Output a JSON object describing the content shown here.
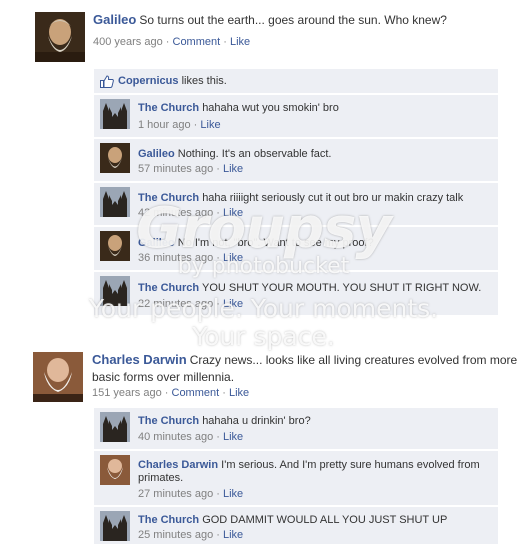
{
  "posts": [
    {
      "author": "Galileo",
      "body": "So turns out the earth... goes around the sun.  Who knew?",
      "time": "400 years ago",
      "comment_label": "Comment",
      "like_label": "Like",
      "likes": {
        "name": "Copernicus",
        "text": "likes this."
      },
      "comments": [
        {
          "author": "The Church",
          "text": "hahaha wut you smokin' bro",
          "time": "1 hour ago",
          "like": "Like"
        },
        {
          "author": "Galileo",
          "text": "Nothing.  It's an observable fact.",
          "time": "57 minutes ago",
          "like": "Like"
        },
        {
          "author": "The Church",
          "text": "haha riiiight seriously cut it out bro ur makin crazy talk",
          "time": "42 minutes ago",
          "like": "Like"
        },
        {
          "author": "Galileo",
          "text": "No I'm not, \"bro\". Want to see my proof?",
          "time": "36 minutes ago",
          "like": "Like"
        },
        {
          "author": "The Church",
          "text": "YOU SHUT YOUR MOUTH.  YOU SHUT IT RIGHT NOW.",
          "time": "22 minutes ago",
          "like": "Like"
        }
      ]
    },
    {
      "author": "Charles Darwin",
      "body": "Crazy news... looks like all living creatures evolved from more basic forms over millennia.",
      "time": "151 years ago",
      "comment_label": "Comment",
      "like_label": "Like",
      "comments": [
        {
          "author": "The Church",
          "text": " hahaha u drinkin' bro?",
          "time": "40 minutes ago",
          "like": "Like"
        },
        {
          "author": "Charles Darwin",
          "text": "I'm serious.  And I'm pretty sure humans evolved from primates.",
          "time": "27 minutes ago",
          "like": "Like"
        },
        {
          "author": "The Church",
          "text": "GOD DAMMIT WOULD ALL YOU JUST SHUT UP",
          "time": "25 minutes ago",
          "like": "Like"
        }
      ]
    }
  ],
  "watermark": {
    "logo": "Groupsy",
    "by": "by photobucket",
    "tagline_1": "Your people. Your moments.",
    "tagline_2": "Your space."
  },
  "colors": {
    "link": "#3b5998",
    "box": "#edeff4",
    "meta": "#808080"
  }
}
